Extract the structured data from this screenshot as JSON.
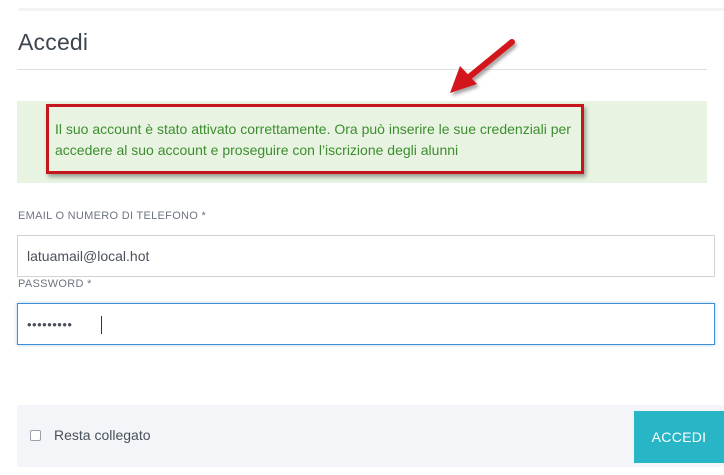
{
  "login": {
    "title": "Accedi",
    "alert_message": "Il suo account è stato attivato correttamente. Ora può inserire le sue credenziali per accedere al suo account e proseguire con l’iscrizione degli alunni",
    "email_label": "EMAIL O NUMERO DI TELEFONO *",
    "email_value": "latuamail@local.hot",
    "password_label": "PASSWORD *",
    "password_value": "•••••••••",
    "remember_label": "Resta collegato",
    "remember_checked": false,
    "submit_label": "ACCEDI"
  },
  "colors": {
    "alert_bg": "#e8f4e1",
    "alert_text": "#3c8d2f",
    "highlight_border": "#c4161c",
    "focus_border": "#3f8fd8",
    "submit_bg": "#28b5c6",
    "footer_bg": "#f3f5f8"
  },
  "icons": {
    "annotation": "red-arrow-icon"
  }
}
